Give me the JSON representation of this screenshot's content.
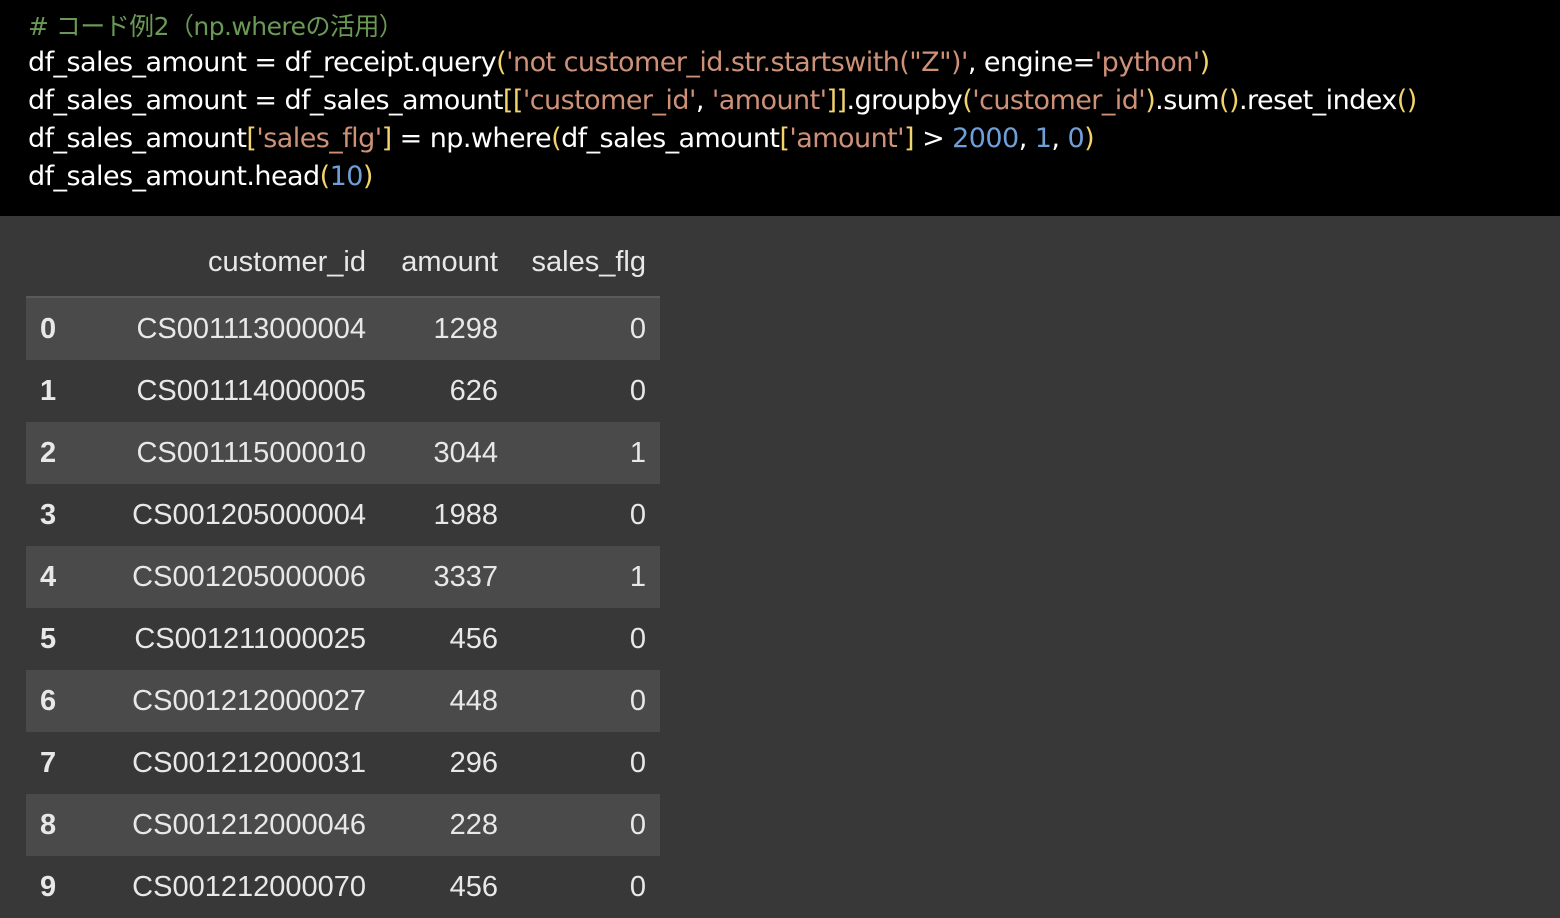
{
  "code_cell": {
    "comment": "# コード例2（np.whereの活用）",
    "lines": [
      [
        {
          "t": "df_sales_amount = df_receipt.query",
          "c": "pl"
        },
        {
          "t": "(",
          "c": "br"
        },
        {
          "t": "'not customer_id.str.startswith(\"Z\")'",
          "c": "str"
        },
        {
          "t": ", engine=",
          "c": "pl"
        },
        {
          "t": "'python'",
          "c": "str"
        },
        {
          "t": ")",
          "c": "br"
        }
      ],
      [
        {
          "t": "df_sales_amount = df_sales_amount",
          "c": "pl"
        },
        {
          "t": "[[",
          "c": "br"
        },
        {
          "t": "'customer_id'",
          "c": "str"
        },
        {
          "t": ", ",
          "c": "pl"
        },
        {
          "t": "'amount'",
          "c": "str"
        },
        {
          "t": "]]",
          "c": "br"
        },
        {
          "t": ".groupby",
          "c": "pl"
        },
        {
          "t": "(",
          "c": "br"
        },
        {
          "t": "'customer_id'",
          "c": "str"
        },
        {
          "t": ")",
          "c": "br"
        },
        {
          "t": ".sum",
          "c": "pl"
        },
        {
          "t": "()",
          "c": "br"
        },
        {
          "t": ".reset_index",
          "c": "pl"
        },
        {
          "t": "()",
          "c": "br"
        }
      ],
      [
        {
          "t": "df_sales_amount",
          "c": "pl"
        },
        {
          "t": "[",
          "c": "br"
        },
        {
          "t": "'sales_flg'",
          "c": "str"
        },
        {
          "t": "]",
          "c": "br"
        },
        {
          "t": " = np.where",
          "c": "pl"
        },
        {
          "t": "(",
          "c": "br"
        },
        {
          "t": "df_sales_amount",
          "c": "pl"
        },
        {
          "t": "[",
          "c": "br"
        },
        {
          "t": "'amount'",
          "c": "str"
        },
        {
          "t": "]",
          "c": "br"
        },
        {
          "t": " > ",
          "c": "pl"
        },
        {
          "t": "2000",
          "c": "num"
        },
        {
          "t": ", ",
          "c": "pl"
        },
        {
          "t": "1",
          "c": "num"
        },
        {
          "t": ", ",
          "c": "pl"
        },
        {
          "t": "0",
          "c": "num"
        },
        {
          "t": ")",
          "c": "br"
        }
      ],
      [
        {
          "t": "df_sales_amount.head",
          "c": "pl"
        },
        {
          "t": "(",
          "c": "br"
        },
        {
          "t": "10",
          "c": "num"
        },
        {
          "t": ")",
          "c": "br"
        }
      ]
    ]
  },
  "output": {
    "columns": [
      "",
      "customer_id",
      "amount",
      "sales_flg"
    ],
    "rows": [
      {
        "index": "0",
        "customer_id": "CS001113000004",
        "amount": "1298",
        "sales_flg": "0"
      },
      {
        "index": "1",
        "customer_id": "CS001114000005",
        "amount": "626",
        "sales_flg": "0"
      },
      {
        "index": "2",
        "customer_id": "CS001115000010",
        "amount": "3044",
        "sales_flg": "1"
      },
      {
        "index": "3",
        "customer_id": "CS001205000004",
        "amount": "1988",
        "sales_flg": "0"
      },
      {
        "index": "4",
        "customer_id": "CS001205000006",
        "amount": "3337",
        "sales_flg": "1"
      },
      {
        "index": "5",
        "customer_id": "CS001211000025",
        "amount": "456",
        "sales_flg": "0"
      },
      {
        "index": "6",
        "customer_id": "CS001212000027",
        "amount": "448",
        "sales_flg": "0"
      },
      {
        "index": "7",
        "customer_id": "CS001212000031",
        "amount": "296",
        "sales_flg": "0"
      },
      {
        "index": "8",
        "customer_id": "CS001212000046",
        "amount": "228",
        "sales_flg": "0"
      },
      {
        "index": "9",
        "customer_id": "CS001212000070",
        "amount": "456",
        "sales_flg": "0"
      }
    ]
  },
  "colors": {
    "code_background": "#000000",
    "output_background": "#383838",
    "comment": "#6a9955",
    "string": "#ce9178",
    "number": "#6f9fd8",
    "bracket": "#f3d36b",
    "row_stripe": "#4a4a4a"
  }
}
